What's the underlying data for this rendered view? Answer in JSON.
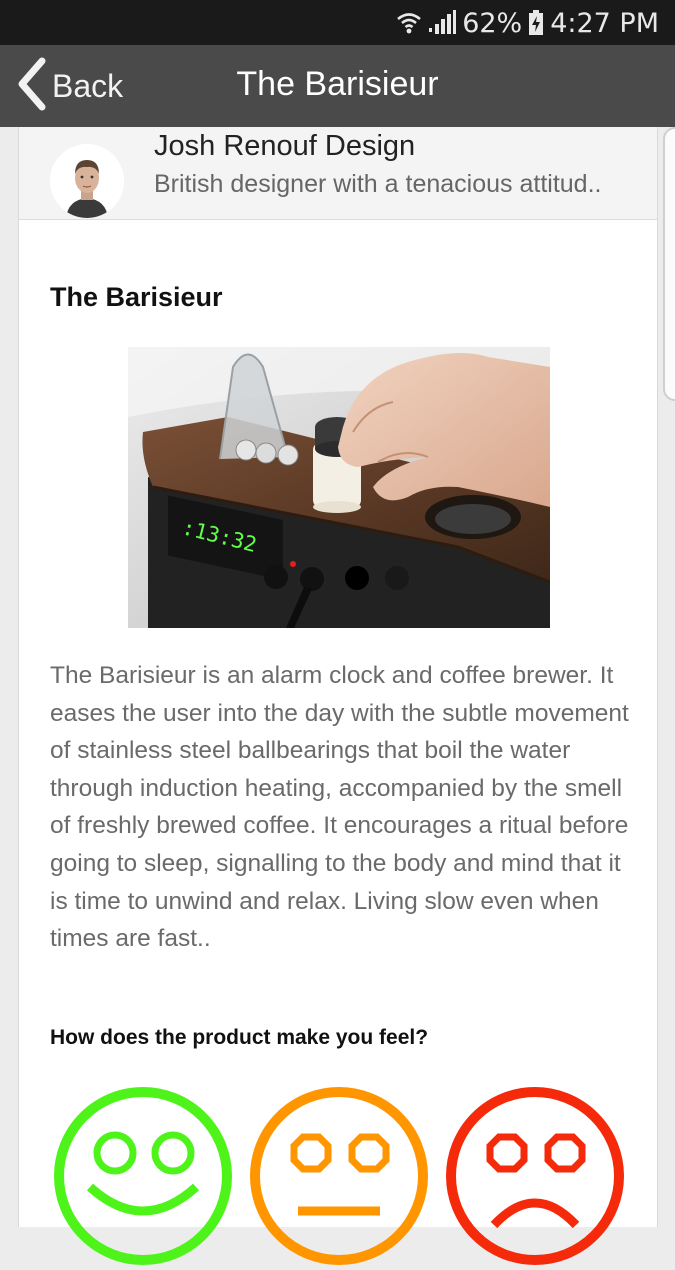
{
  "status_bar": {
    "battery": "62%",
    "time": "4:27 PM",
    "icons": [
      "wifi-icon",
      "signal-icon",
      "battery-icon"
    ]
  },
  "nav": {
    "back_label": "Back",
    "title": "The Barisieur"
  },
  "author": {
    "name": "Josh Renouf Design",
    "bio": "British designer with a tenacious attitud.."
  },
  "article": {
    "title": "The Barisieur",
    "image_description": "Barisieur alarm clock and coffee brewer",
    "clock_display": ":13:32",
    "body": "The Barisieur is an alarm clock and coffee brewer. It eases the user into the day with the subtle movement of stainless steel ballbearings that boil the water through induction heating, accompanied by the smell of freshly brewed coffee. It encourages a ritual before going to sleep, signalling to the body and mind that it is time to unwind and relax. Living slow even when times are fast.."
  },
  "carousel": {
    "total": 2,
    "active_index": 0
  },
  "feedback": {
    "question": "How does the product make you feel?",
    "options": [
      {
        "name": "happy",
        "color": "#4ef31a"
      },
      {
        "name": "neutral",
        "color": "#ff9600"
      },
      {
        "name": "sad",
        "color": "#f52a0a"
      }
    ]
  },
  "colors": {
    "status_bar_bg": "#1a1a1a",
    "nav_bar_bg": "#4a4a4a"
  }
}
